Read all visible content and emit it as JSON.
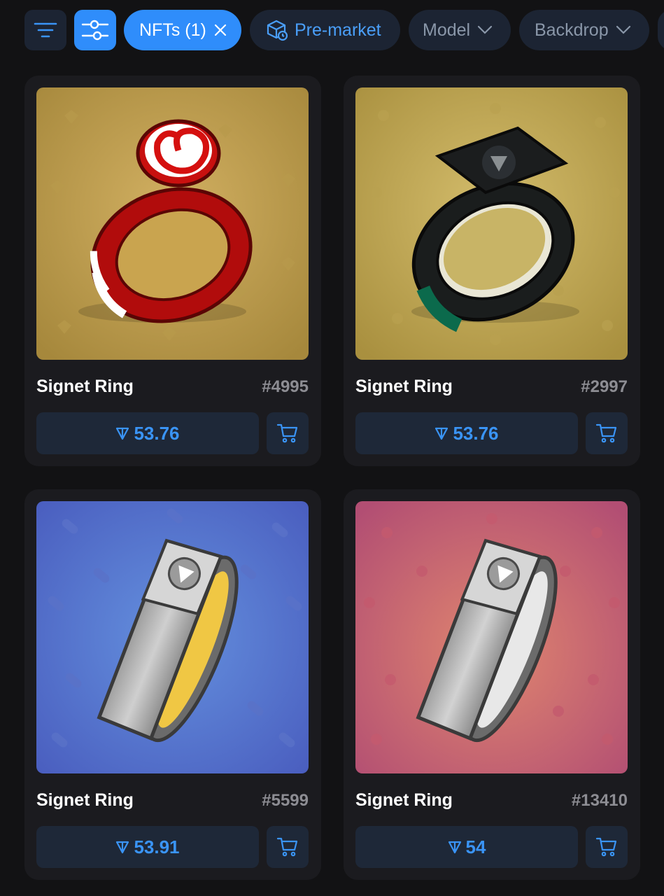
{
  "filters": {
    "nfts_chip": "NFTs (1)",
    "premarket_chip": "Pre-market",
    "model_chip": "Model",
    "backdrop_chip": "Backdrop"
  },
  "colors": {
    "accent": "#2f8dfb",
    "price": "#3a94f6",
    "card_bg": "#1b1b1f",
    "button_bg": "#1e2838"
  },
  "items": [
    {
      "name": "Signet Ring",
      "number": "#4995",
      "price": "53.76",
      "model": "candy-stripe",
      "backdrop": "gold"
    },
    {
      "name": "Signet Ring",
      "number": "#2997",
      "price": "53.76",
      "model": "black-emerald",
      "backdrop": "gold"
    },
    {
      "name": "Signet Ring",
      "number": "#5599",
      "price": "53.91",
      "model": "silver-gold",
      "backdrop": "blue"
    },
    {
      "name": "Signet Ring",
      "number": "#13410",
      "price": "54",
      "model": "silver",
      "backdrop": "pink"
    }
  ],
  "icons": {
    "sort": "sort-lines-icon",
    "settings": "sliders-icon",
    "close": "close-icon",
    "premarket": "box-clock-icon",
    "chevron": "chevron-down-icon",
    "ton": "ton-icon",
    "cart": "cart-icon"
  }
}
